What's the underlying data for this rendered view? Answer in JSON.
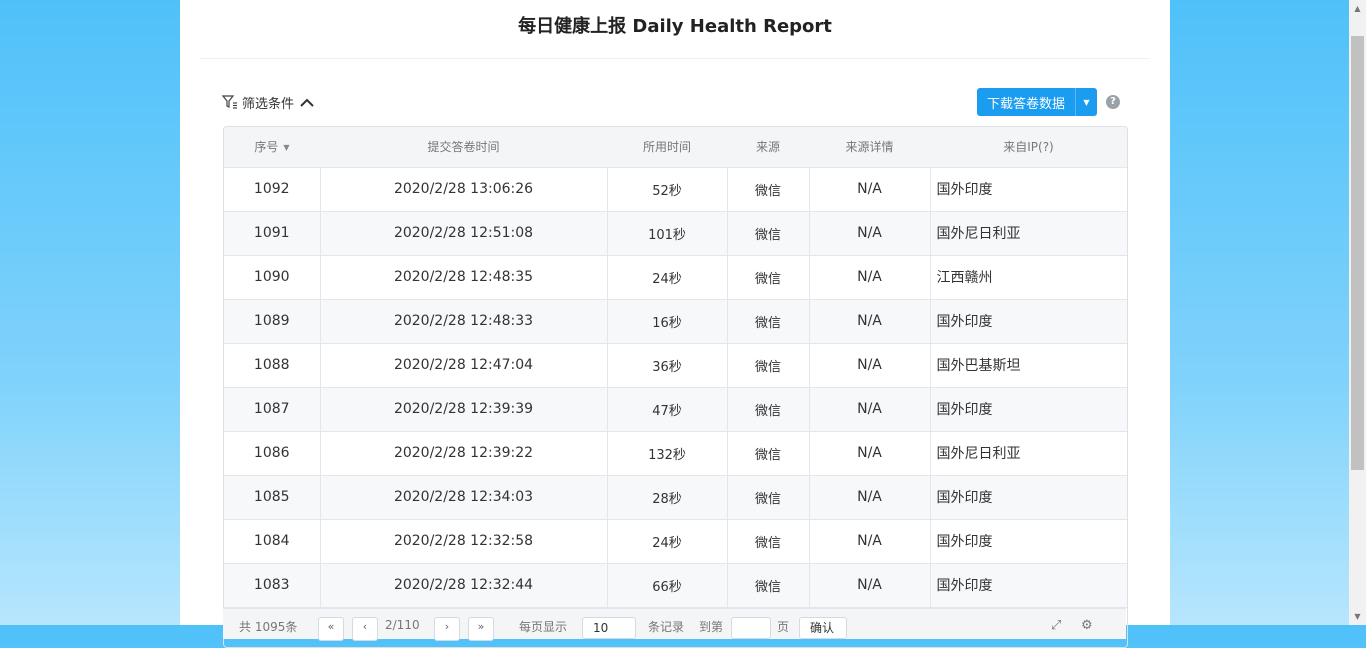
{
  "title": "每日健康上报 Daily Health Report",
  "toolbar": {
    "filter_label": "筛选条件",
    "download_label": "下载答卷数据",
    "help_text": "?"
  },
  "table": {
    "headers": [
      "序号",
      "提交答卷时间",
      "所用时间",
      "来源",
      "来源详情",
      "来自IP(?)"
    ],
    "rows": [
      [
        "1092",
        "2020/2/28 13:06:26",
        "52秒",
        "微信",
        "N/A",
        "国外印度"
      ],
      [
        "1091",
        "2020/2/28 12:51:08",
        "101秒",
        "微信",
        "N/A",
        "国外尼日利亚"
      ],
      [
        "1090",
        "2020/2/28 12:48:35",
        "24秒",
        "微信",
        "N/A",
        "江西赣州"
      ],
      [
        "1089",
        "2020/2/28 12:48:33",
        "16秒",
        "微信",
        "N/A",
        "国外印度"
      ],
      [
        "1088",
        "2020/2/28 12:47:04",
        "36秒",
        "微信",
        "N/A",
        "国外巴基斯坦"
      ],
      [
        "1087",
        "2020/2/28 12:39:39",
        "47秒",
        "微信",
        "N/A",
        "国外印度"
      ],
      [
        "1086",
        "2020/2/28 12:39:22",
        "132秒",
        "微信",
        "N/A",
        "国外尼日利亚"
      ],
      [
        "1085",
        "2020/2/28 12:34:03",
        "28秒",
        "微信",
        "N/A",
        "国外印度"
      ],
      [
        "1084",
        "2020/2/28 12:32:58",
        "24秒",
        "微信",
        "N/A",
        "国外印度"
      ],
      [
        "1083",
        "2020/2/28 12:32:44",
        "66秒",
        "微信",
        "N/A",
        "国外印度"
      ]
    ]
  },
  "pager": {
    "total": "共 1095条",
    "page": "2/110",
    "per_page_label": "每页显示",
    "per_page_value": "10",
    "records_label": "条记录",
    "goto_label": "到第",
    "page_unit": "页",
    "confirm_label": "确认"
  },
  "colors": {
    "accent": "#1a9cf1",
    "background_top": "#4fc1f9"
  }
}
